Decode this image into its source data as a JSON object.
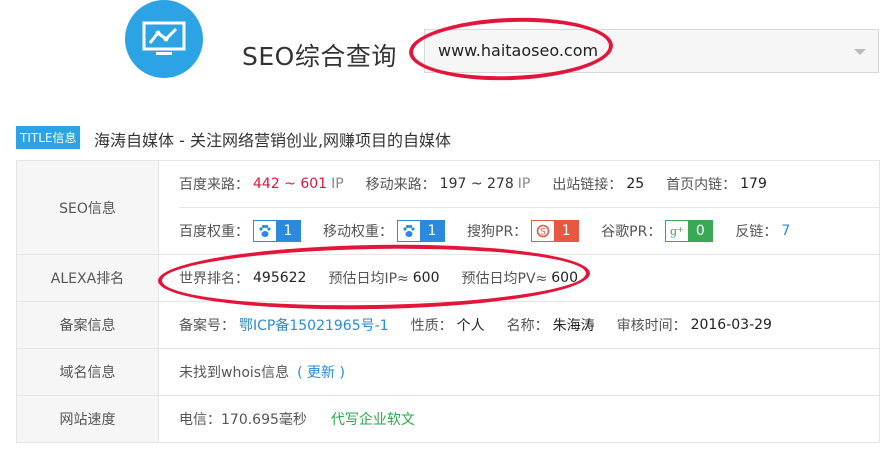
{
  "header": {
    "title": "SEO综合查询",
    "domain_value": "www.haitaoseo.com",
    "logo_icon": "chart-monitor-icon"
  },
  "title_info": {
    "badge": "TITLE信息",
    "text": "海涛自媒体 - 关注网络营销创业,网赚项目的自媒体"
  },
  "seo": {
    "label": "SEO信息",
    "baidu_traffic_label": "百度来路：",
    "baidu_traffic_value": "442 ~ 601",
    "baidu_traffic_unit": "IP",
    "mobile_traffic_label": "移动来路：",
    "mobile_traffic_value": "197 ~ 278",
    "mobile_traffic_unit": "IP",
    "outbound_label": "出站链接：",
    "outbound_value": "25",
    "internal_label": "首页内链：",
    "internal_value": "179",
    "baidu_weight_label": "百度权重：",
    "baidu_weight_value": "1",
    "mobile_weight_label": "移动权重：",
    "mobile_weight_value": "1",
    "sogou_pr_label": "搜狗PR：",
    "sogou_pr_value": "1",
    "google_pr_label": "谷歌PR：",
    "google_pr_value": "0",
    "backlinks_label": "反链：",
    "backlinks_value": "7"
  },
  "alexa": {
    "label": "ALEXA排名",
    "world_rank_label": "世界排名：",
    "world_rank_value": "495622",
    "ip_label": "预估日均IP≈",
    "ip_value": "600",
    "pv_label": "预估日均PV≈",
    "pv_value": "600"
  },
  "icp": {
    "label": "备案信息",
    "number_label": "备案号：",
    "number_value": "鄂ICP备15021965号-1",
    "nature_label": "性质：",
    "nature_value": "个人",
    "name_label": "名称：",
    "name_value": "朱海涛",
    "audit_label": "审核时间：",
    "audit_value": "2016-03-29"
  },
  "domain_info": {
    "label": "域名信息",
    "text": "未找到whois信息",
    "update_link": "( 更新 )"
  },
  "speed": {
    "label": "网站速度",
    "text": "电信：170.695毫秒",
    "ad_link": "代写企业软文"
  }
}
